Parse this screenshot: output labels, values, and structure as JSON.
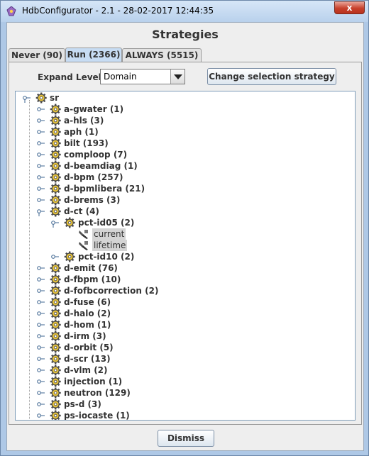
{
  "window": {
    "title": "HdbConfigurator  - 2.1  -  28-02-2017  12:44:35",
    "close_glyph": "x"
  },
  "heading": "Strategies",
  "tabs": [
    {
      "label": "Never (90)",
      "active": false
    },
    {
      "label": "Run (2366)",
      "active": true
    },
    {
      "label": "ALWAYS (5515)",
      "active": false
    }
  ],
  "toolbar": {
    "expand_label": "Expand Level:",
    "expand_value": "Domain",
    "change_button": "Change selection strategy"
  },
  "tree": {
    "root": "sr",
    "items": [
      {
        "label": "a-gwater (1)",
        "level": 1,
        "expanded": false
      },
      {
        "label": "a-hls (3)",
        "level": 1,
        "expanded": false
      },
      {
        "label": "aph (1)",
        "level": 1,
        "expanded": false
      },
      {
        "label": "bilt (193)",
        "level": 1,
        "expanded": false
      },
      {
        "label": "comploop (7)",
        "level": 1,
        "expanded": false
      },
      {
        "label": "d-beamdiag (1)",
        "level": 1,
        "expanded": false
      },
      {
        "label": "d-bpm (257)",
        "level": 1,
        "expanded": false
      },
      {
        "label": "d-bpmlibera (21)",
        "level": 1,
        "expanded": false
      },
      {
        "label": "d-brems (3)",
        "level": 1,
        "expanded": false
      },
      {
        "label": "d-ct (4)",
        "level": 1,
        "expanded": true
      },
      {
        "label": "pct-id05 (2)",
        "level": 2,
        "expanded": true
      },
      {
        "label": "current",
        "level": 3,
        "leaf": true
      },
      {
        "label": "lifetime",
        "level": 3,
        "leaf": true
      },
      {
        "label": "pct-id10 (2)",
        "level": 2,
        "expanded": false
      },
      {
        "label": "d-emit (76)",
        "level": 1,
        "expanded": false
      },
      {
        "label": "d-fbpm (10)",
        "level": 1,
        "expanded": false
      },
      {
        "label": "d-fofbcorrection (2)",
        "level": 1,
        "expanded": false
      },
      {
        "label": "d-fuse (6)",
        "level": 1,
        "expanded": false
      },
      {
        "label": "d-halo (2)",
        "level": 1,
        "expanded": false
      },
      {
        "label": "d-hom (1)",
        "level": 1,
        "expanded": false
      },
      {
        "label": "d-irm (3)",
        "level": 1,
        "expanded": false
      },
      {
        "label": "d-orbit (5)",
        "level": 1,
        "expanded": false
      },
      {
        "label": "d-scr (13)",
        "level": 1,
        "expanded": false
      },
      {
        "label": "d-vlm (2)",
        "level": 1,
        "expanded": false
      },
      {
        "label": "injection (1)",
        "level": 1,
        "expanded": false
      },
      {
        "label": "neutron (129)",
        "level": 1,
        "expanded": false
      },
      {
        "label": "ps-d (3)",
        "level": 1,
        "expanded": false
      },
      {
        "label": "ps-iocaste (1)",
        "level": 1,
        "expanded": false
      }
    ]
  },
  "footer": {
    "dismiss_button": "Dismiss"
  },
  "colors": {
    "tab_active": "#c7dcf3",
    "leaf_highlight": "#d4d4d4",
    "close_button": "#c7402b"
  }
}
